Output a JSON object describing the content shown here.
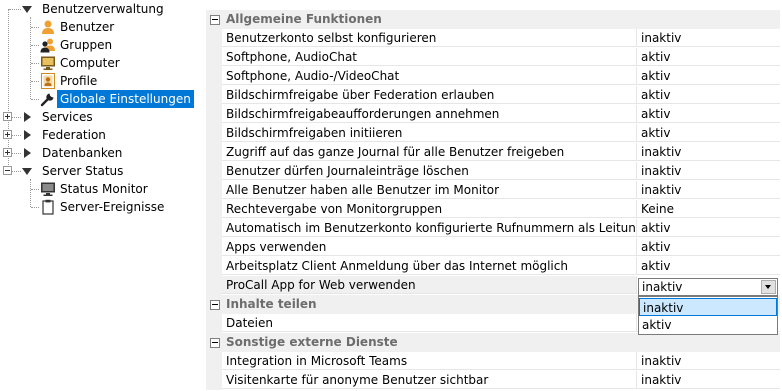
{
  "tree": {
    "items": [
      {
        "label": "Benutzerverwaltung",
        "expanded": true
      },
      {
        "label": "Benutzer"
      },
      {
        "label": "Gruppen"
      },
      {
        "label": "Computer"
      },
      {
        "label": "Profile"
      },
      {
        "label": "Globale Einstellungen",
        "selected": true
      },
      {
        "label": "Services",
        "expanded": false
      },
      {
        "label": "Federation",
        "expanded": false
      },
      {
        "label": "Datenbanken",
        "expanded": false
      },
      {
        "label": "Server Status",
        "expanded": true
      },
      {
        "label": "Status Monitor"
      },
      {
        "label": "Server-Ereignisse"
      }
    ]
  },
  "grid": {
    "categories": [
      {
        "title": "Allgemeine Funktionen",
        "props": [
          {
            "name": "Benutzerkonto selbst konfigurieren",
            "value": "inaktiv"
          },
          {
            "name": "Softphone, AudioChat",
            "value": "aktiv"
          },
          {
            "name": "Softphone, Audio-/VideoChat",
            "value": "aktiv"
          },
          {
            "name": "Bildschirmfreigabe über Federation erlauben",
            "value": "aktiv"
          },
          {
            "name": "Bildschirmfreigabeaufforderungen annehmen",
            "value": "aktiv"
          },
          {
            "name": "Bildschirmfreigaben initiieren",
            "value": "aktiv"
          },
          {
            "name": "Zugriff auf das ganze Journal für alle Benutzer freigeben",
            "value": "inaktiv"
          },
          {
            "name": "Benutzer dürfen Journaleinträge löschen",
            "value": "inaktiv"
          },
          {
            "name": "Alle Benutzer haben alle Benutzer im Monitor",
            "value": "inaktiv"
          },
          {
            "name": "Rechtevergabe von Monitorgruppen",
            "value": "Keine"
          },
          {
            "name": "Automatisch im Benutzerkonto konfigurierte Rufnummern als Leitung bereitstellen",
            "value": "aktiv"
          },
          {
            "name": "Apps verwenden",
            "value": "aktiv"
          },
          {
            "name": "Arbeitsplatz Client Anmeldung über das Internet möglich",
            "value": "aktiv"
          },
          {
            "name": "ProCall App for Web verwenden",
            "value": "inaktiv",
            "active": true
          }
        ]
      },
      {
        "title": "Inhalte teilen",
        "props": [
          {
            "name": "Dateien",
            "value": "aktiv"
          }
        ]
      },
      {
        "title": "Sonstige externe Dienste",
        "props": [
          {
            "name": "Integration in Microsoft Teams",
            "value": "inaktiv"
          },
          {
            "name": "Visitenkarte für anonyme Benutzer sichtbar",
            "value": "inaktiv"
          }
        ]
      }
    ]
  },
  "editor": {
    "value": "inaktiv",
    "options": [
      "inaktiv",
      "aktiv"
    ],
    "highlighted": 0
  },
  "colors": {
    "selection": "#0078d7",
    "category_bg": "#f0f0f0",
    "category_text": "#6d6d6d"
  }
}
